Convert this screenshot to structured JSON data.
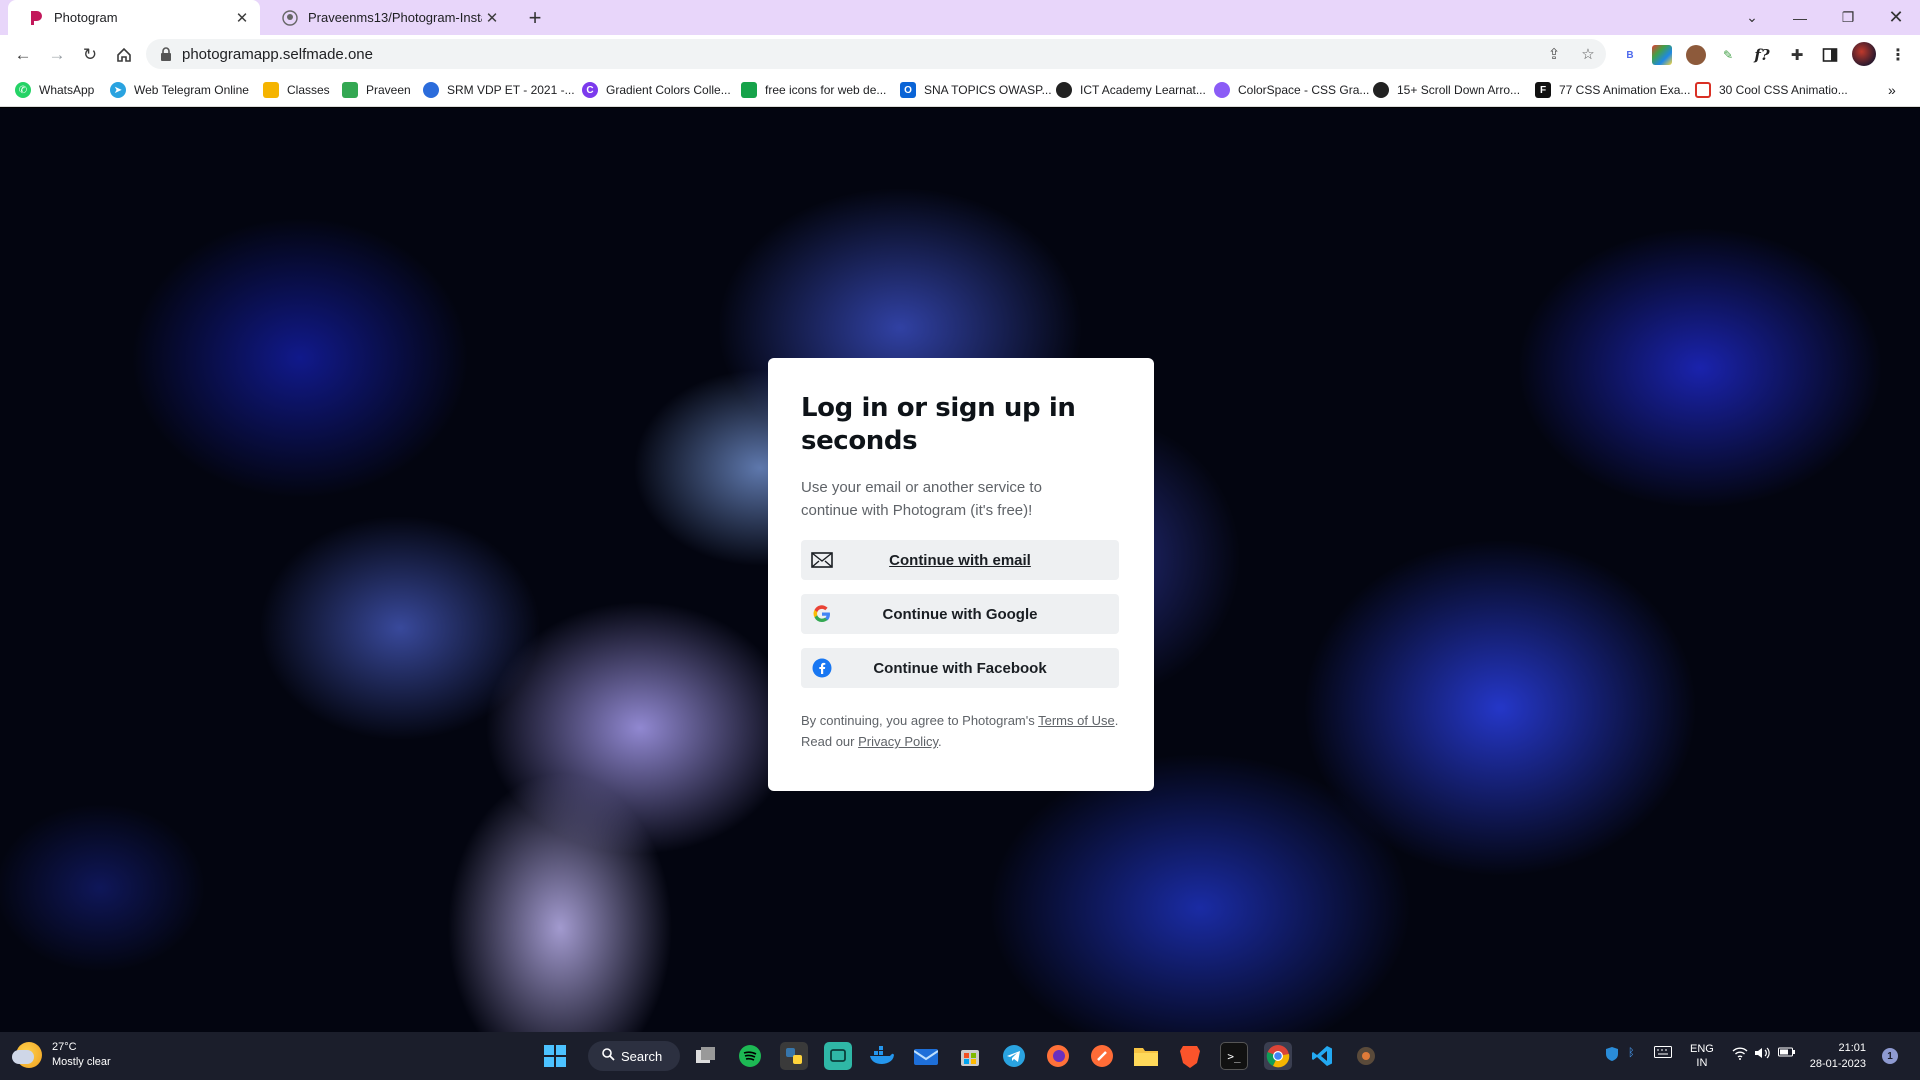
{
  "browser": {
    "tabs": [
      {
        "title": "Photogram",
        "active": true
      },
      {
        "title": "Praveenms13/Photogram-Instagram",
        "active": false
      }
    ],
    "url": "photogramapp.selfmade.one",
    "bookmarks": [
      {
        "label": "WhatsApp",
        "icon": "whatsapp-icon",
        "color": "#25d366"
      },
      {
        "label": "Web Telegram Online",
        "icon": "telegram-icon",
        "color": "#2aa3e0"
      },
      {
        "label": "Classes",
        "icon": "classroom-icon",
        "color": "#f5b400"
      },
      {
        "label": "Praveen",
        "icon": "bookmark-icon",
        "color": "#34a853"
      },
      {
        "label": "SRM VDP ET - 2021 -...",
        "icon": "cloud-icon",
        "color": "#2b6cdb"
      },
      {
        "label": "Gradient Colors Colle...",
        "icon": "gradient-icon",
        "color": "#7c3aed"
      },
      {
        "label": "free icons for web de...",
        "icon": "icons-icon",
        "color": "#16a34a"
      },
      {
        "label": "SNA TOPICS OWASP...",
        "icon": "outlook-icon",
        "color": "#0a64d6"
      },
      {
        "label": "ICT Academy Learnat...",
        "icon": "globe-icon",
        "color": "#222222"
      },
      {
        "label": "ColorSpace - CSS Gra...",
        "icon": "colorspace-icon",
        "color": "#8b5cf6"
      },
      {
        "label": "15+ Scroll Down Arro...",
        "icon": "globe-icon",
        "color": "#222222"
      },
      {
        "label": "77 CSS Animation Exa...",
        "icon": "freefrontend-icon",
        "color": "#111111"
      },
      {
        "label": "30 Cool CSS Animatio...",
        "icon": "mail-icon",
        "color": "#d93025"
      }
    ],
    "overflow_label": "»"
  },
  "card": {
    "title": "Log in or sign up in seconds",
    "subtitle": "Use your email or another service to continue with Photogram (it's free)!",
    "buttons": {
      "email": "Continue with email",
      "google": "Continue with Google",
      "facebook": "Continue with Facebook"
    },
    "legal": {
      "prefix": "By continuing, you agree to Photogram's ",
      "terms": "Terms of Use",
      "middle": ". Read our ",
      "privacy": "Privacy Policy",
      "suffix": "."
    }
  },
  "taskbar": {
    "weather_temp": "27°C",
    "weather_desc": "Mostly clear",
    "search_label": "Search",
    "lang_top": "ENG",
    "lang_bottom": "IN",
    "time": "21:01",
    "date": "28-01-2023",
    "notifications": "1"
  }
}
